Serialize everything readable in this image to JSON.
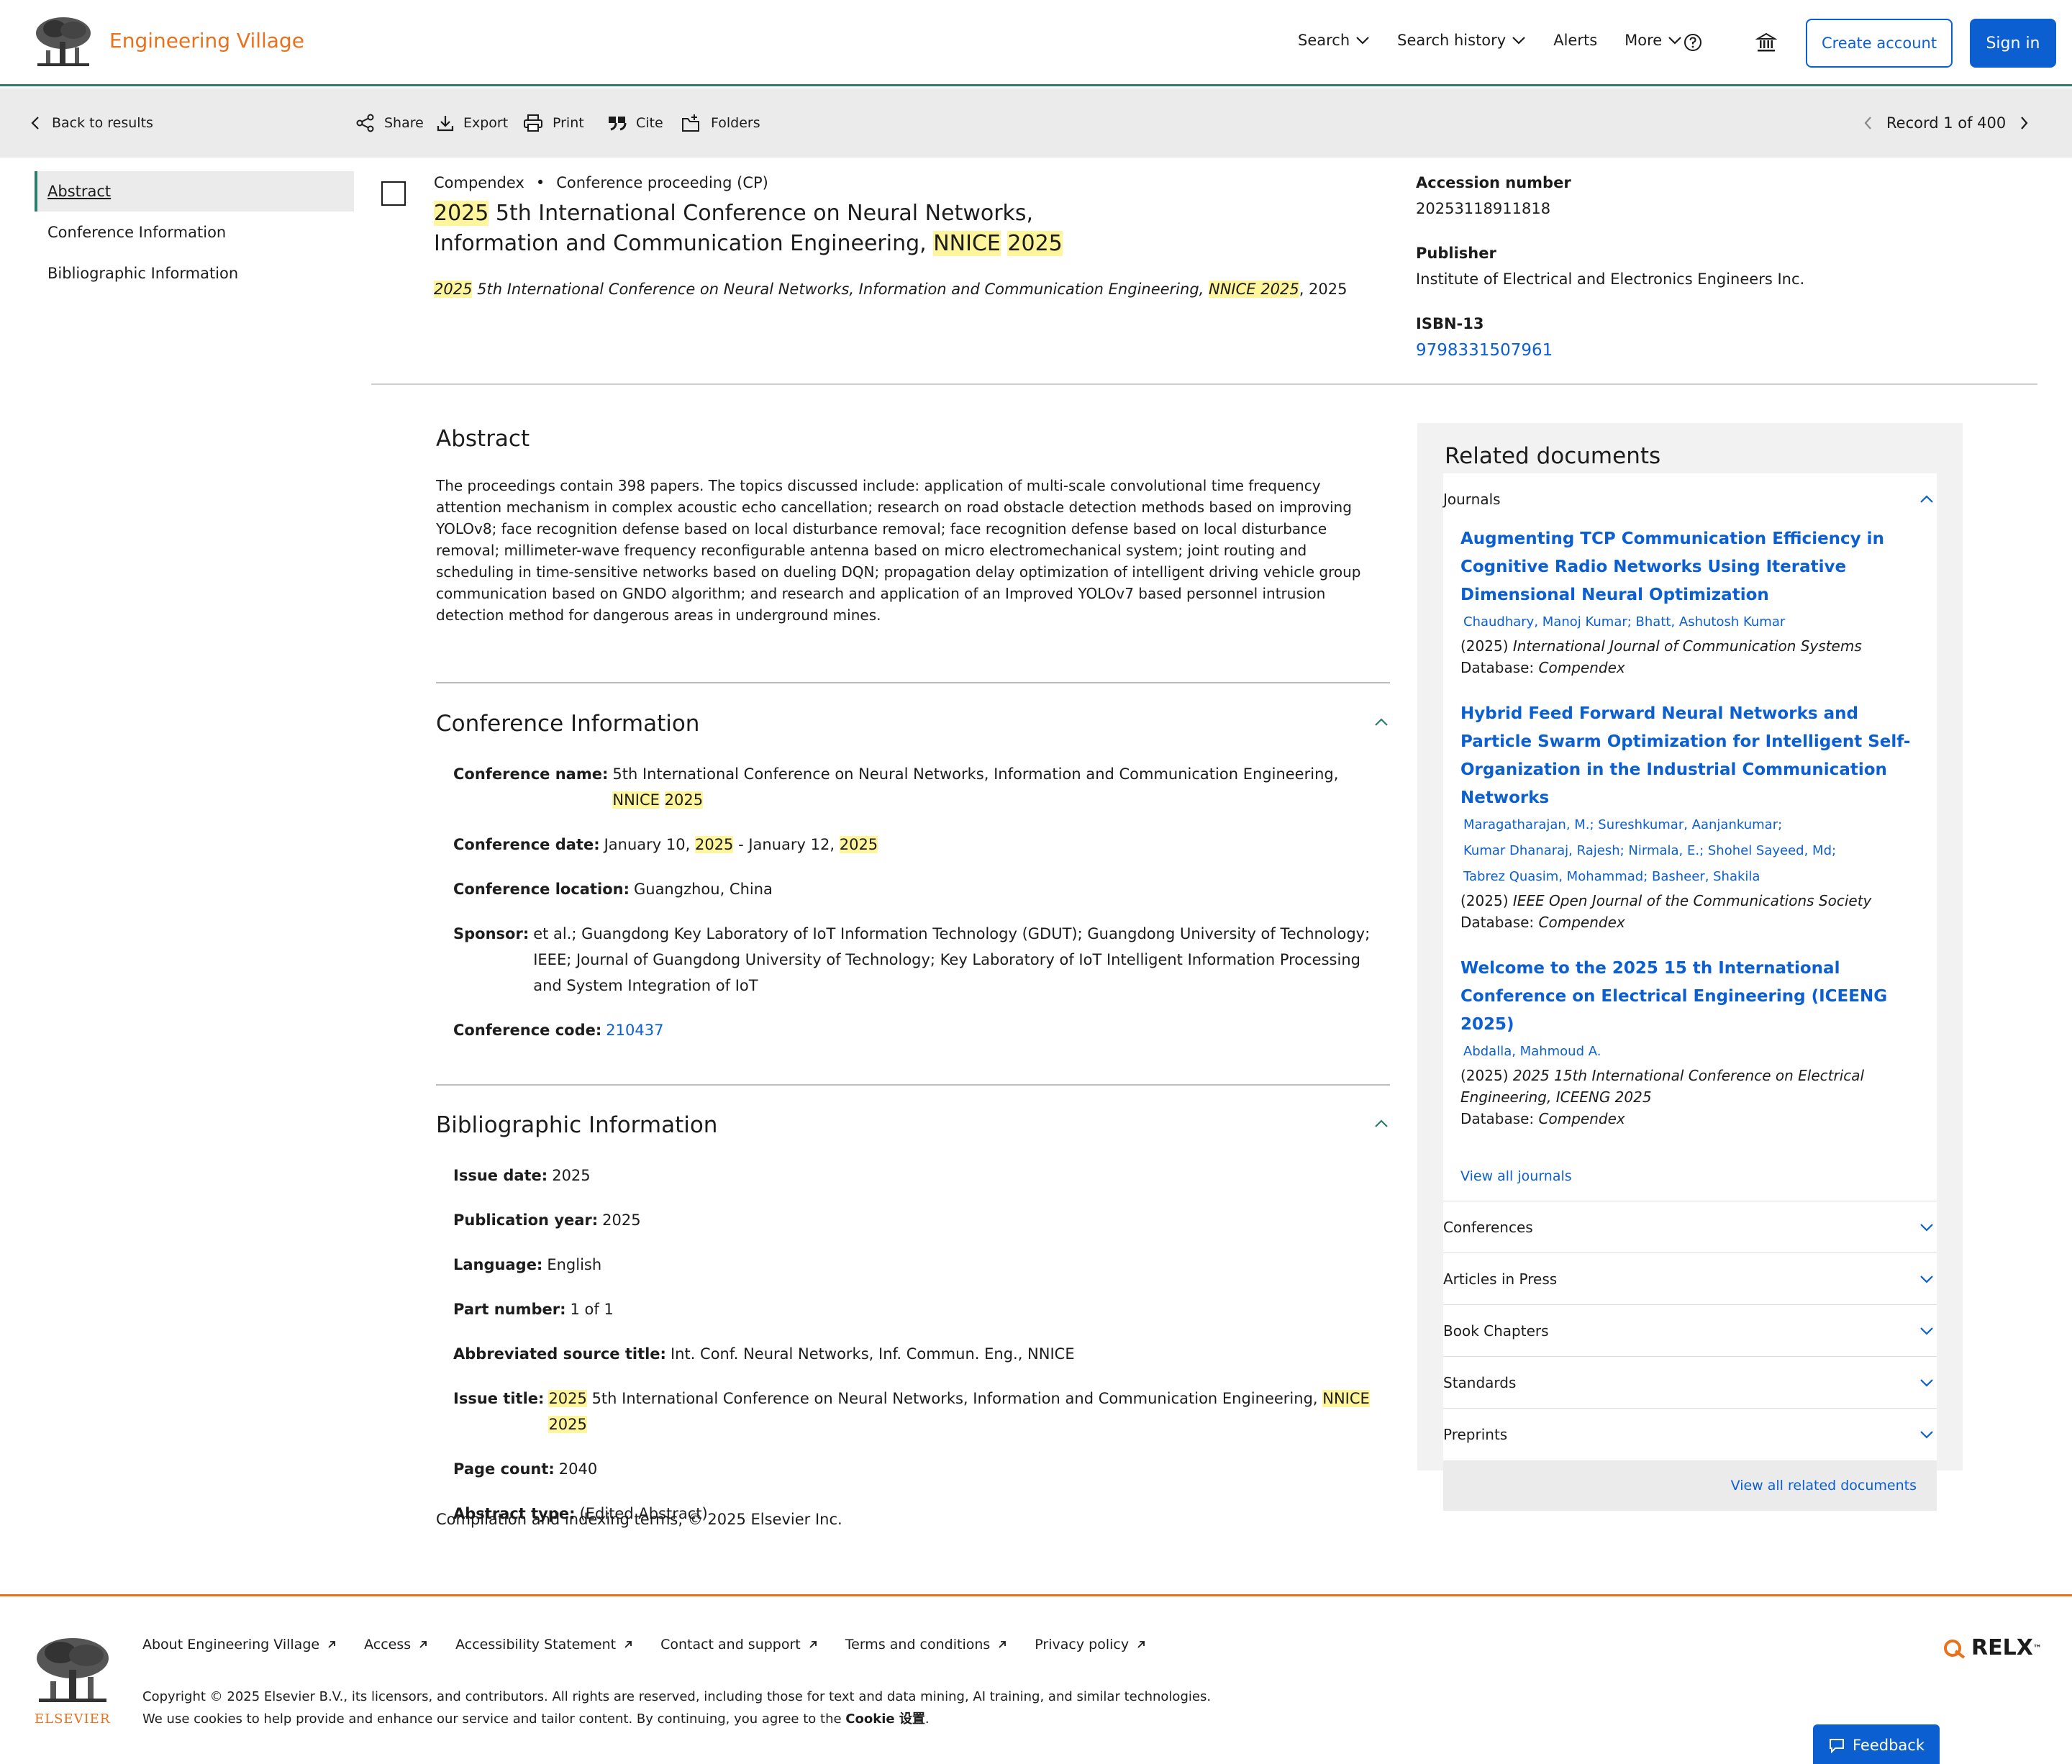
{
  "header": {
    "brand": "Engineering Village",
    "nav": [
      "Search",
      "Search history",
      "Alerts",
      "More"
    ],
    "create_account": "Create account",
    "sign_in": "Sign in"
  },
  "toolbar": {
    "back": "Back to results",
    "actions": [
      "Share",
      "Export",
      "Print",
      "Cite",
      "Folders"
    ],
    "record": "Record 1 of 400"
  },
  "leftnav": [
    "Abstract",
    "Conference Information",
    "Bibliographic Information"
  ],
  "record": {
    "database": "Compendex",
    "doc_type": "Conference proceeding (CP)",
    "title_a": "2025",
    "title_b": " 5th International Conference on Neural Networks, Information and Communication Engineering, ",
    "title_c": "NNICE",
    "title_d": " ",
    "title_e": "2025",
    "sub_a": "2025",
    "sub_b": " 5th International Conference on Neural Networks, Information and Communication Engineering, ",
    "sub_c": "NNICE 2025",
    "sub_d": ", 2025",
    "accession_label": "Accession number",
    "accession_value": "20253118911818",
    "publisher_label": "Publisher",
    "publisher_value": "Institute of Electrical and Electronics Engineers Inc.",
    "isbn_label": "ISBN-13",
    "isbn_value": "9798331507961"
  },
  "abstract": {
    "heading": "Abstract",
    "text": "The proceedings contain 398 papers. The topics discussed include: application of multi-scale convolutional time frequency attention mechanism in complex acoustic echo cancellation; research on road obstacle detection methods based on improving YOLOv8; face recognition defense based on local disturbance removal; face recognition defense based on local disturbance removal; millimeter-wave frequency reconfigurable antenna based on micro electromechanical system; joint routing and scheduling in time-sensitive networks based on dueling DQN; propagation delay optimization of intelligent driving vehicle group communication based on GNDO algorithm; and research and application of an Improved YOLOv7 based personnel intrusion detection method for dangerous areas in underground mines."
  },
  "conference": {
    "heading": "Conference Information",
    "name_label": "Conference name:",
    "name_a": "5th International Conference on Neural Networks, Information and Communication Engineering, ",
    "name_b": "NNICE",
    "name_c": " ",
    "name_d": "2025",
    "date_label": "Conference date:",
    "date_a": "January 10, ",
    "date_b": "2025",
    "date_c": " - January 12, ",
    "date_d": "2025",
    "location_label": "Conference location:",
    "location": "Guangzhou, China",
    "sponsor_label": "Sponsor:",
    "sponsor": "et al.; Guangdong Key Laboratory of IoT Information Technology (GDUT); Guangdong University of Technology; IEEE; Journal of Guangdong University of Technology; Key Laboratory of IoT Intelligent Information Processing and System Integration of IoT",
    "code_label": "Conference code:",
    "code": "210437"
  },
  "bibliographic": {
    "heading": "Bibliographic Information",
    "issue_date_label": "Issue date:",
    "issue_date": "2025",
    "pub_year_label": "Publication year:",
    "pub_year": "2025",
    "language_label": "Language:",
    "language": "English",
    "part_label": "Part number:",
    "part": "1 of 1",
    "abbr_label": "Abbreviated source title:",
    "abbr": "Int. Conf. Neural Networks, Inf. Commun. Eng., NNICE",
    "issue_title_label": "Issue title:",
    "issue_title_a": "2025",
    "issue_title_b": " 5th International Conference on Neural Networks, Information and Communication Engineering, ",
    "issue_title_c": "NNICE 2025",
    "page_count_label": "Page count:",
    "page_count": "2040",
    "abstract_type_label": "Abstract type:",
    "abstract_type": "(Edited Abstract)"
  },
  "compilation": "Compilation and indexing terms, © 2025 Elsevier Inc.",
  "related": {
    "heading": "Related documents",
    "journals_label": "Journals",
    "docs": [
      {
        "title": "Augmenting TCP Communication Efficiency in Cognitive Radio Networks Using Iterative Dimensional Neural Optimization",
        "authors": [
          "Chaudhary, Manoj Kumar; Bhatt, Ashutosh Kumar"
        ],
        "year": "(2025) ",
        "source": "International Journal of Communication Systems",
        "db_label": "Database: ",
        "db": "Compendex"
      },
      {
        "title": "Hybrid Feed Forward Neural Networks and Particle Swarm Optimization for Intelligent Self-Organization in the Industrial Communication Networks",
        "authors": [
          "Maragatharajan, M.; Sureshkumar, Aanjankumar;",
          "Kumar Dhanaraj, Rajesh; Nirmala, E.; Shohel Sayeed, Md;",
          "Tabrez Quasim, Mohammad; Basheer, Shakila"
        ],
        "year": "(2025) ",
        "source": "IEEE Open Journal of the Communications Society",
        "db_label": "Database: ",
        "db": "Compendex"
      },
      {
        "title": "Welcome to the 2025 15 th International Conference on Electrical Engineering (ICEENG 2025)",
        "authors": [
          "Abdalla, Mahmoud A."
        ],
        "year": "(2025) ",
        "source": "2025 15th International Conference on Electrical Engineering, ICEENG 2025",
        "db_label": "Database: ",
        "db": "Compendex"
      }
    ],
    "view_all_journals": "View all journals",
    "sections": [
      "Conferences",
      "Articles in Press",
      "Book Chapters",
      "Standards",
      "Preprints"
    ],
    "view_all": "View all related documents"
  },
  "footer": {
    "elsevier": "ELSEVIER",
    "links": [
      "About Engineering Village",
      "Access",
      "Accessibility Statement",
      "Contact and support",
      "Terms and conditions",
      "Privacy policy"
    ],
    "copyright": "Copyright © 2025 Elsevier B.V., its licensors, and contributors. All rights are reserved, including those for text and data mining, AI training, and similar technologies.",
    "cookies_a": "We use cookies to help provide and enhance our service and tailor content. By continuing, you agree to the ",
    "cookies_b": "Cookie 设置",
    "cookies_c": ".",
    "relx": "RELX",
    "relx_tm": "™",
    "feedback": "Feedback"
  }
}
